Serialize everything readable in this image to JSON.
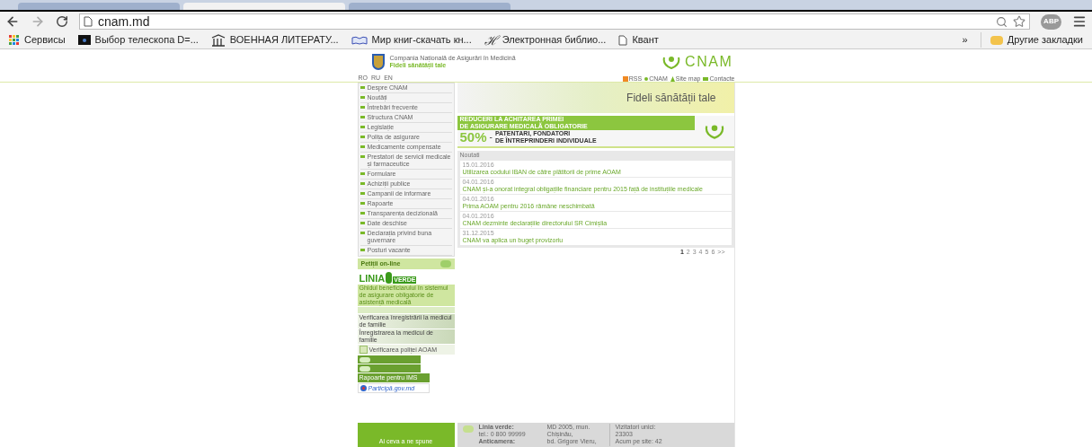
{
  "browser": {
    "url": "cnam.md",
    "tabs": [
      {
        "selected": false
      },
      {
        "selected": true
      },
      {
        "selected": false
      }
    ],
    "adblock": "ABP",
    "bookmarks": [
      {
        "label": "Сервисы",
        "kind": "apps"
      },
      {
        "label": "Выбор телескопа D=...",
        "kind": "dark"
      },
      {
        "label": "ВОЕННАЯ ЛИТЕРАТУ...",
        "kind": "columns"
      },
      {
        "label": "Мир книг-скачать кн...",
        "kind": "book"
      },
      {
        "label": "Электронная библио...",
        "kind": "letter",
        "glyph": "ℋ"
      },
      {
        "label": "Квант",
        "kind": "page"
      }
    ],
    "overflow": "»",
    "other_bookmarks": "Другие закладки"
  },
  "header": {
    "org": "Compania Națională de Asigurări în Medicină",
    "motto": "Fideli sănătății tale",
    "logo": "CNAM",
    "languages": [
      "RO",
      "RU",
      "EN"
    ],
    "links": [
      {
        "label": "RSS",
        "kind": "rss"
      },
      {
        "label": "CNAM",
        "kind": "dot"
      },
      {
        "label": "Site map",
        "kind": "map"
      },
      {
        "label": "Contacte",
        "kind": "mail"
      }
    ]
  },
  "menu": [
    {
      "label": "Despre CNAM"
    },
    {
      "label": "Noutăți"
    },
    {
      "label": "Întrebări frecvente"
    },
    {
      "label": "Structura CNAM"
    },
    {
      "label": "Legislație"
    },
    {
      "label": "Polița de asigurare"
    },
    {
      "label": "Medicamente compensate"
    },
    {
      "label": "Prestatori de servicii medicale și farmaceutice"
    },
    {
      "label": "Formulare"
    },
    {
      "label": "Achiziții publice"
    },
    {
      "label": "Campanii de informare"
    },
    {
      "label": "Rapoarte"
    },
    {
      "label": "Transparența decizională"
    },
    {
      "label": "Date deschise"
    },
    {
      "label": "Declarația privind buna guvernare"
    },
    {
      "label": "Posturi vacante"
    }
  ],
  "side_banners": [
    {
      "kind": "petitions",
      "text": "Petiții on-line"
    },
    {
      "kind": "linia",
      "text": "LINIA",
      "sub": "VERDE"
    },
    {
      "kind": "guide",
      "text": "Ghidul beneficiarului în sistemul de asigurare obligatorie de asistență medicală"
    },
    {
      "kind": "plain"
    },
    {
      "kind": "photo",
      "text": "Verificarea înregistrării la medicul de familie"
    },
    {
      "kind": "photo",
      "text": "Înregistrarea la medicul de familie"
    },
    {
      "kind": "policy",
      "text": "Verificarea poliței AOAM"
    },
    {
      "kind": "greenicon"
    },
    {
      "kind": "greenicon"
    },
    {
      "kind": "ims",
      "text": "Rapoarte pentru IMS"
    },
    {
      "kind": "gov",
      "text": "Participă.gov.md"
    }
  ],
  "hero": {
    "slogan": "Fideli sănătății tale"
  },
  "promo": {
    "line1": "REDUCERI LA ACHITAREA PRIMEI",
    "line2": "DE ASIGURARE MEDICALĂ OBLIGATORIE",
    "percent": "50%",
    "dash": "-",
    "who1": "PATENTARI, FONDATORI",
    "who2": "DE ÎNTREPRINDERI INDIVIDUALE"
  },
  "news": {
    "title": "Noutati",
    "items": [
      {
        "date": "15.01.2016",
        "title": "Utilizarea codului IBAN de către plătitorii de prime AOAM"
      },
      {
        "date": "04.01.2016",
        "title": "CNAM și-a onorat integral obligațiile financiare pentru 2015 față de instituțiile medicale"
      },
      {
        "date": "04.01.2016",
        "title": "Prima AOAM pentru 2016 rămâne neschimbată"
      },
      {
        "date": "04.01.2016",
        "title": "CNAM dezminte declarațiile directorului SR Cimișlia"
      },
      {
        "date": "31.12.2015",
        "title": "CNAM va aplica un buget provizoriu"
      }
    ],
    "pages": [
      {
        "label": "1",
        "selected": true
      },
      {
        "label": "2",
        "selected": false
      },
      {
        "label": "3",
        "selected": false
      },
      {
        "label": "4",
        "selected": false
      },
      {
        "label": "5",
        "selected": false
      },
      {
        "label": "6",
        "selected": false
      },
      {
        "label": ">>",
        "selected": false
      }
    ]
  },
  "footer": {
    "feedback": "Ai ceva a ne spune",
    "contact": [
      "Linia verde:",
      "tel.: 0 800 99999",
      "Anticamera:"
    ],
    "address": [
      "MD 2005, mun.",
      "Chișinău,",
      "bd. Grigore Vieru,"
    ],
    "visitors": [
      "Vizitatori unici:",
      "23303",
      "Acum pe site: 42"
    ]
  }
}
